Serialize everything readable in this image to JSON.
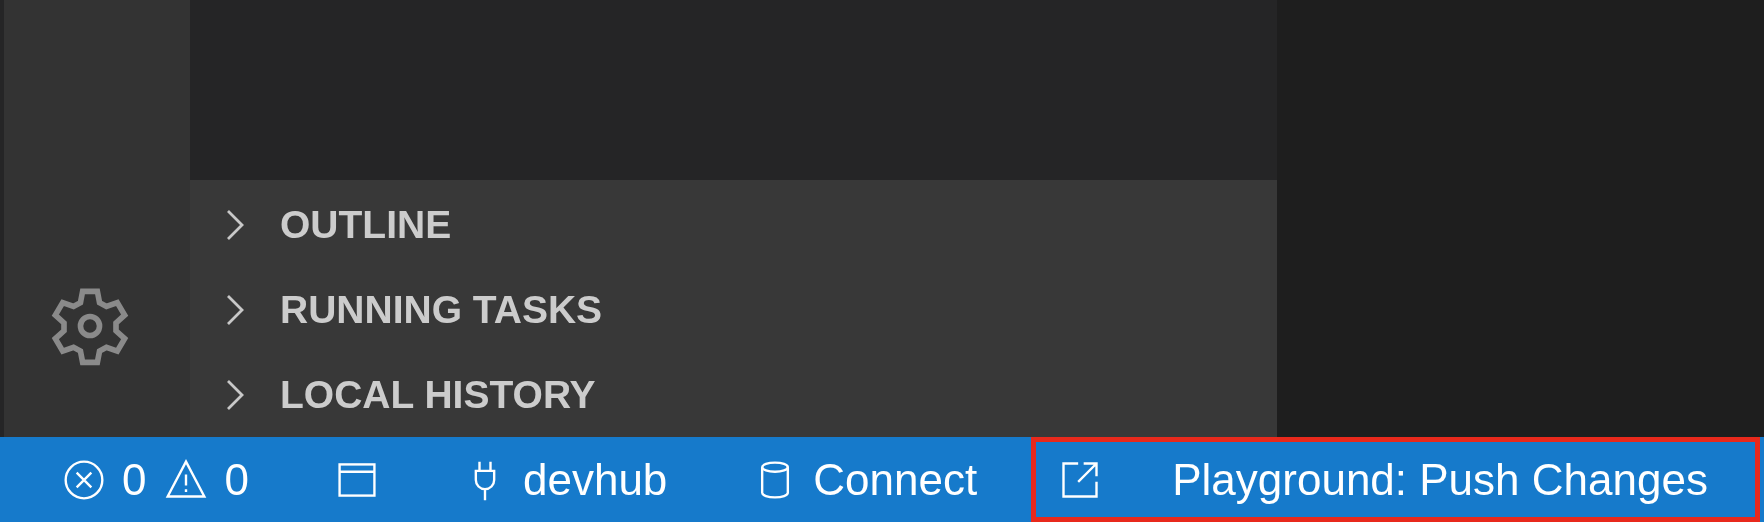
{
  "sidebar": {
    "sections": [
      {
        "label": "OUTLINE",
        "expanded": false
      },
      {
        "label": "RUNNING TASKS",
        "expanded": false
      },
      {
        "label": "LOCAL HISTORY",
        "expanded": false
      }
    ]
  },
  "status_bar": {
    "items": [
      {
        "kind": "problems",
        "errors": "0",
        "warnings": "0"
      },
      {
        "kind": "layout"
      },
      {
        "kind": "plug",
        "label": "devhub"
      },
      {
        "kind": "database",
        "label": "Connect"
      },
      {
        "kind": "external",
        "label": "Playground: Push Changes",
        "highlighted": true
      }
    ]
  }
}
